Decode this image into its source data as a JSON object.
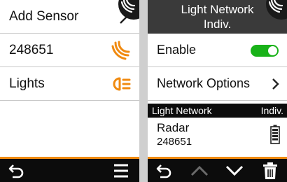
{
  "left_screen": {
    "rows": [
      {
        "label": "Add Sensor",
        "icon": "chevron-right-icon"
      },
      {
        "label": "248651",
        "icon": "radar-signal-icon"
      },
      {
        "label": "Lights",
        "icon": "headlight-icon"
      }
    ],
    "bottom_bar": {
      "buttons": [
        "back-icon",
        "menu-icon"
      ]
    }
  },
  "right_screen": {
    "header": {
      "line1": "Light Network",
      "line2": "Indiv."
    },
    "rows": [
      {
        "label": "Enable",
        "control": "toggle",
        "on": true
      },
      {
        "label": "Network Options",
        "icon": "chevron-right-icon"
      }
    ],
    "section": {
      "left": "Light Network",
      "right": "Indiv."
    },
    "device": {
      "name": "Radar",
      "id": "248651",
      "icon": "battery-icon"
    },
    "bottom_bar": {
      "buttons": [
        "back-icon",
        "up-icon",
        "down-icon",
        "trash-icon"
      ]
    }
  },
  "colors": {
    "accent": "#f08a10",
    "toggle_on": "#19b219",
    "header_bg": "#3a3a3a",
    "bar_bg": "#0c0c0c"
  }
}
